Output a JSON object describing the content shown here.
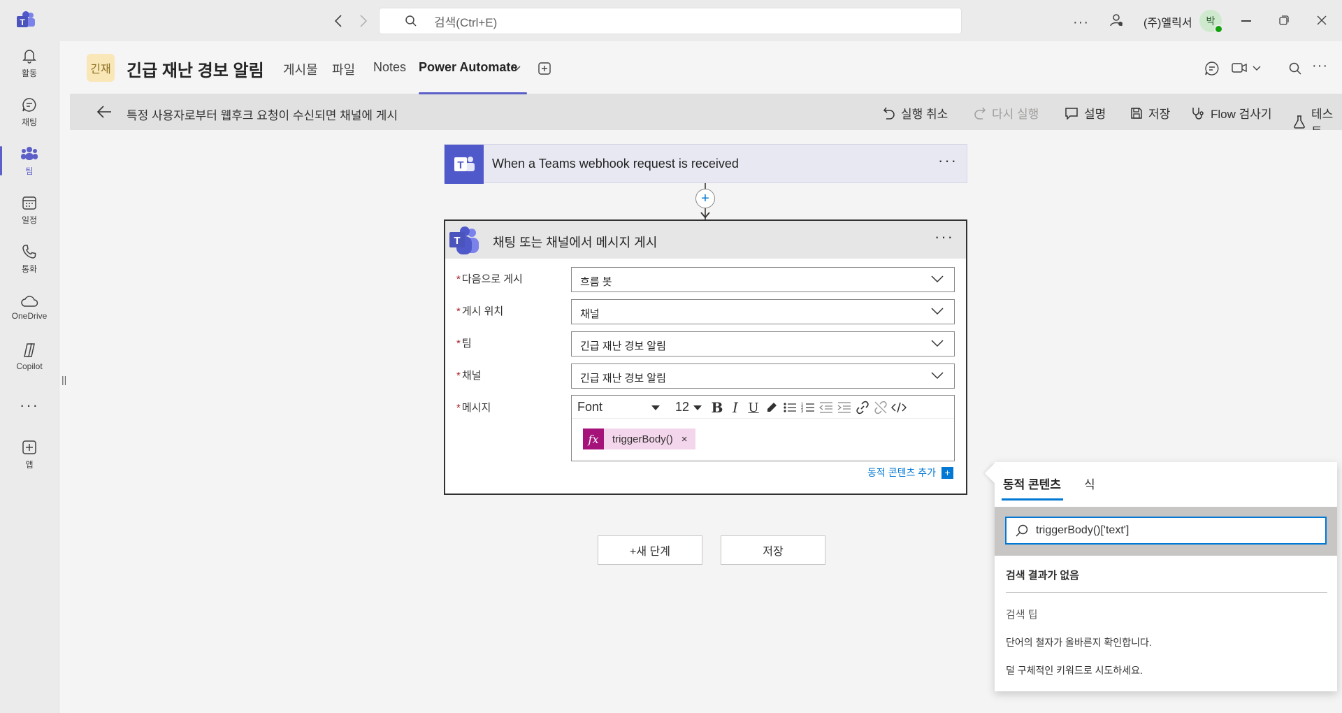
{
  "titlebar": {
    "search_placeholder": "검색(Ctrl+E)",
    "user_name": "(주)엘릭서",
    "avatar_initial": "박",
    "presence": "available"
  },
  "rail": {
    "items": [
      {
        "label": "활동",
        "icon": "bell-icon"
      },
      {
        "label": "채팅",
        "icon": "chat-icon"
      },
      {
        "label": "팀",
        "icon": "teams-icon",
        "active": true
      },
      {
        "label": "일정",
        "icon": "calendar-icon"
      },
      {
        "label": "통화",
        "icon": "phone-icon"
      },
      {
        "label": "OneDrive",
        "icon": "cloud-icon"
      },
      {
        "label": "Copilot",
        "icon": "copilot-icon"
      },
      {
        "label": "앱",
        "icon": "add-app-icon"
      }
    ]
  },
  "channel": {
    "badge": "긴재",
    "title": "긴급 재난 경보 알림",
    "tabs": [
      "게시물",
      "파일",
      "Notes",
      "Power Automate"
    ],
    "active_tab": "Power Automate"
  },
  "flowbar": {
    "title": "특정 사용자로부터 웹후크 요청이 수신되면 채널에 게시",
    "commands": {
      "undo": "실행 취소",
      "redo": "다시 실행",
      "comment": "설명",
      "save": "저장",
      "checker": "Flow 검사기",
      "test": "테스트"
    }
  },
  "trigger": {
    "title": "When a Teams webhook request is received"
  },
  "action": {
    "title": "채팅 또는 채널에서 메시지 게시",
    "fields": [
      {
        "label": "다음으로 게시",
        "value": "흐름 봇"
      },
      {
        "label": "게시 위치",
        "value": "채널"
      },
      {
        "label": "팀",
        "value": "긴급 재난 경보 알림"
      },
      {
        "label": "채널",
        "value": "긴급 재난 경보 알림"
      }
    ],
    "message_label": "메시지",
    "editor": {
      "font": "Font",
      "size": "12"
    },
    "token": {
      "fx": "fx",
      "text": "triggerBody()",
      "remove": "×"
    },
    "add_dynamic": "동적 콘텐츠 추가"
  },
  "canvas_buttons": {
    "new_step": "+새 단계",
    "save": "저장"
  },
  "flyout": {
    "tabs": [
      "동적 콘텐츠",
      "식"
    ],
    "search_value": "triggerBody()['text']",
    "no_results": "검색 결과가 없음",
    "tips_heading": "검색 팁",
    "tips": [
      "단어의 철자가 올바른지 확인합니다.",
      "덜 구체적인 키워드로 시도하세요."
    ]
  },
  "colors": {
    "teams_purple": "#5b5fc7",
    "accent_blue": "#0078d4",
    "expression_magenta": "#a4127a"
  }
}
